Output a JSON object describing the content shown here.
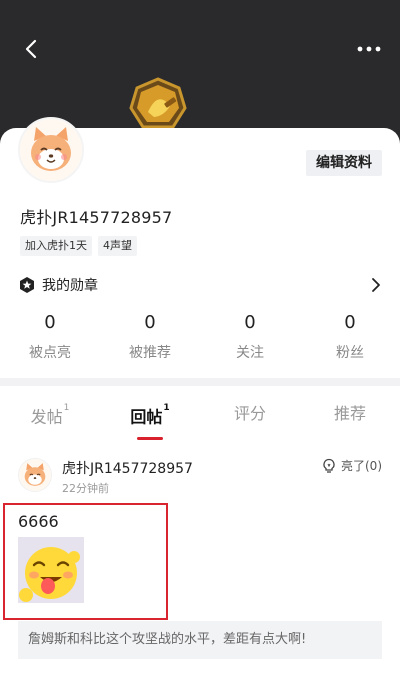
{
  "header": {
    "back_icon": "chevron-left-icon",
    "more_icon": "more-dots-icon"
  },
  "profile": {
    "edit_label": "编辑资料",
    "username": "虎扑JR1457728957",
    "tags": [
      "加入虎扑1天",
      "4声望"
    ],
    "medal_label": "我的勋章",
    "stats": [
      {
        "value": "0",
        "label": "被点亮"
      },
      {
        "value": "0",
        "label": "被推荐"
      },
      {
        "value": "0",
        "label": "关注"
      },
      {
        "value": "0",
        "label": "粉丝"
      }
    ]
  },
  "tabs": [
    {
      "label": "发帖",
      "count": "1"
    },
    {
      "label": "回帖",
      "count": "1"
    },
    {
      "label": "评分",
      "count": ""
    },
    {
      "label": "推荐",
      "count": ""
    }
  ],
  "active_tab": "回帖",
  "post": {
    "user": "虎扑JR1457728957",
    "time": "22分钟前",
    "like_label": "亮了(0)",
    "content": "6666",
    "quote": "詹姆斯和科比这个攻坚战的水平，差距有点大啊!"
  },
  "colors": {
    "accent": "#d8212c",
    "header_bg": "#2a2a2c",
    "highlight_box": "#d9252f"
  }
}
